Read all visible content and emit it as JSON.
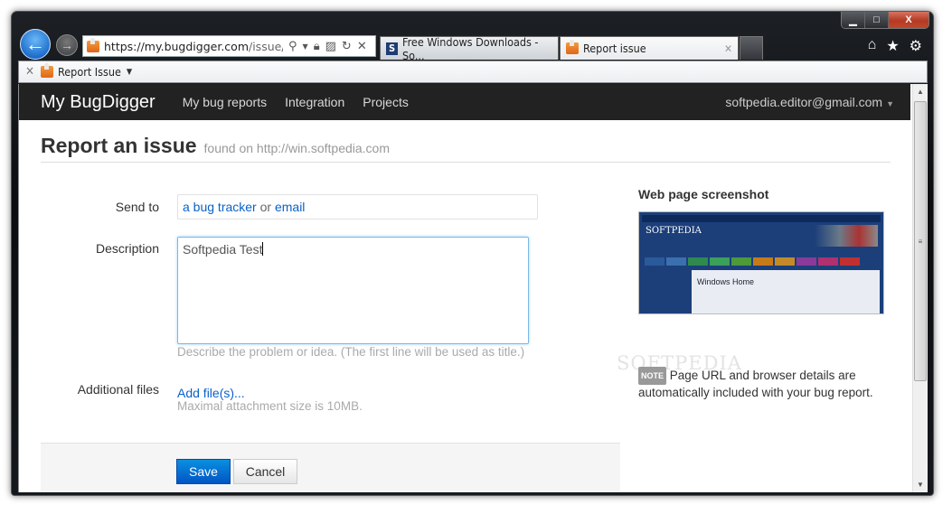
{
  "browser": {
    "address_url_host": "https://my.bugdigger.com",
    "address_url_path": "/issue/rep",
    "tabs": [
      {
        "label": "Free Windows Downloads - So...",
        "icon": "softpedia-icon",
        "active": false
      },
      {
        "label": "Report issue",
        "icon": "bugdigger-icon",
        "active": true
      }
    ],
    "favorites_bar": {
      "item_label": "Report Issue"
    },
    "window_controls": {
      "minimize": "▁",
      "maximize": "□",
      "close": "X"
    }
  },
  "site": {
    "brand": "My BugDigger",
    "nav": [
      "My bug reports",
      "Integration",
      "Projects"
    ],
    "account_email": "softpedia.editor@gmail.com"
  },
  "page": {
    "title": "Report an issue",
    "subtitle": "found on http://win.softpedia.com"
  },
  "form": {
    "send_to": {
      "label": "Send to",
      "link1": "a bug tracker",
      "or": "or",
      "link2": "email"
    },
    "description": {
      "label": "Description",
      "value": "Softpedia Test",
      "help": "Describe the problem or idea. (The first line will be used as title.)"
    },
    "files": {
      "label": "Additional files",
      "link": "Add file(s)...",
      "help": "Maximal attachment size is 10MB."
    },
    "save_label": "Save",
    "cancel_label": "Cancel"
  },
  "sidebar": {
    "screenshot_title": "Web page screenshot",
    "thumbnail": {
      "logo": "SOFTPEDIA",
      "heading": "Windows Home",
      "menu_colors": [
        "#2a5a9a",
        "#3b6fb0",
        "#2f8a4e",
        "#3aa05a",
        "#4c9a3a",
        "#c77a1a",
        "#c48a2a",
        "#8a3a9a",
        "#b03070",
        "#c03030"
      ]
    },
    "note_badge": "NOTE",
    "note_text": "Page URL and browser details are automatically included with your bug report."
  },
  "watermark": "SOFTPEDIA"
}
